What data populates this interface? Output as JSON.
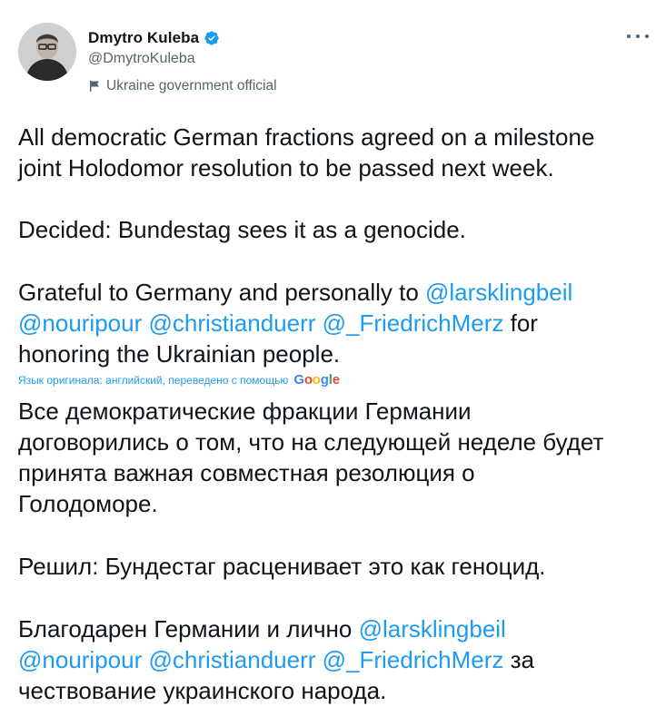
{
  "author": {
    "name": "Dmytro Kuleba",
    "handle": "@DmytroKuleba",
    "label": "Ukraine government official"
  },
  "original": {
    "para1": [
      "All democratic German fractions agreed on a milestone",
      "joint Holodomor resolution to be passed next week."
    ],
    "para2": "Decided: Bundestag sees it as a genocide.",
    "para3": {
      "line1_text": "Grateful to Germany and personally to ",
      "mention1": "@larsklingbeil",
      "mention2": "@nouripour",
      "mention3": "@christianduerr",
      "mention4": "@_FriedrichMerz",
      "line2_tail": " for",
      "line3": "honoring the Ukrainian people."
    }
  },
  "translation_note": {
    "text": "Язык оригинала: английский, переведено с помощью",
    "google_letters": [
      "G",
      "o",
      "o",
      "g",
      "l",
      "e"
    ]
  },
  "translated": {
    "para1": [
      "Все демократические фракции Германии",
      "договорились о том, что на следующей неделе будет",
      "принята важная совместная резолюция о",
      "Голодоморе."
    ],
    "para2": "Решил: Бундестаг расценивает это как геноцид.",
    "para3": {
      "line1_text": "Благодарен Германии и лично ",
      "mention1": "@larsklingbeil",
      "mention2": "@nouripour",
      "mention3": "@christianduerr",
      "mention4": "@_FriedrichMerz",
      "line2_tail": " за",
      "line3": "чествование украинского народа."
    }
  },
  "colors": {
    "text": "#0f1419",
    "secondary": "#536471",
    "link": "#1d9bf0",
    "verified": "#1d9bf0"
  },
  "icons": {
    "verified": "verified-badge-icon",
    "flag": "flag-icon",
    "more": "more-options-icon"
  }
}
